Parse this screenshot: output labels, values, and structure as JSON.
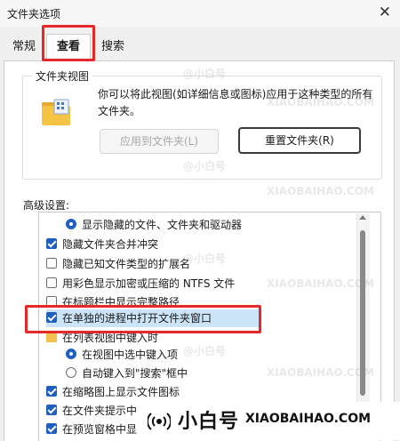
{
  "window": {
    "title": "文件夹选项"
  },
  "tabs": [
    {
      "label": "常规",
      "active": false
    },
    {
      "label": "查看",
      "active": true
    },
    {
      "label": "搜索",
      "active": false
    }
  ],
  "folder_view": {
    "legend": "文件夹视图",
    "description": "你可以将此视图(如详细信息或图标)应用于这种类型的所有文件夹。",
    "apply_button": "应用到文件夹(L)",
    "reset_button": "重置文件夹(R)"
  },
  "advanced": {
    "label": "高级设置:",
    "items": [
      {
        "type": "radio",
        "checked": true,
        "label": "显示隐藏的文件、文件夹和驱动器"
      },
      {
        "type": "checkbox",
        "checked": true,
        "label": "隐藏文件夹合并冲突"
      },
      {
        "type": "checkbox",
        "checked": false,
        "label": "隐藏已知文件类型的扩展名"
      },
      {
        "type": "checkbox",
        "checked": false,
        "label": "用彩色显示加密或压缩的 NTFS 文件"
      },
      {
        "type": "checkbox",
        "checked": false,
        "label": "在标题栏中显示完整路径"
      },
      {
        "type": "checkbox",
        "checked": true,
        "label": "在单独的进程中打开文件夹窗口"
      },
      {
        "type": "folder",
        "label": "在列表视图中键入时"
      },
      {
        "type": "radio",
        "checked": true,
        "label": "在视图中选中键入项"
      },
      {
        "type": "radio",
        "checked": false,
        "label": "自动键入到\"搜索\"框中"
      },
      {
        "type": "checkbox",
        "checked": true,
        "label": "在缩略图上显示文件图标"
      },
      {
        "type": "checkbox",
        "checked": true,
        "label": "在文件夹提示中"
      },
      {
        "type": "checkbox",
        "checked": true,
        "label": "在预览窗格中显"
      }
    ]
  },
  "watermark": {
    "handle": "@小白号",
    "brand_cn": "小白号",
    "brand_en": "XIAOBAIHAO.COM"
  },
  "colors": {
    "annotation": "#e5292a",
    "check_blue": "#1f5fbf",
    "folder": "#f2c14e"
  }
}
